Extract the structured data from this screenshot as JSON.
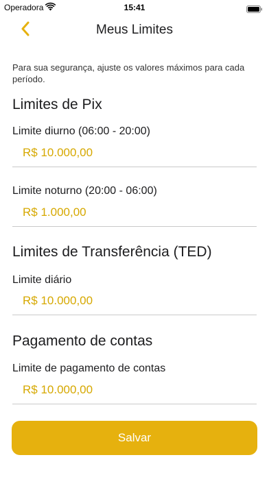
{
  "status_bar": {
    "carrier": "Operadora",
    "time": "15:41"
  },
  "nav": {
    "title": "Meus Limites",
    "back_icon": "chevron-left-icon"
  },
  "intro_text": "Para sua segurança, ajuste os valores máximos para cada período.",
  "sections": {
    "pix": {
      "title": "Limites de Pix",
      "daytime_label": "Limite diurno (06:00 - 20:00)",
      "daytime_value": "R$ 10.000,00",
      "night_label": "Limite noturno (20:00 - 06:00)",
      "night_value": "R$ 1.000,00"
    },
    "ted": {
      "title": "Limites de Transferência (TED)",
      "daily_label": "Limite diário",
      "daily_value": "R$ 10.000,00"
    },
    "bills": {
      "title": "Pagamento de contas",
      "limit_label": "Limite de pagamento de contas",
      "limit_value": "R$ 10.000,00"
    }
  },
  "save_label": "Salvar",
  "colors": {
    "accent": "#e6b10e",
    "value_text": "#d6a800",
    "divider": "#c9c9c9"
  }
}
